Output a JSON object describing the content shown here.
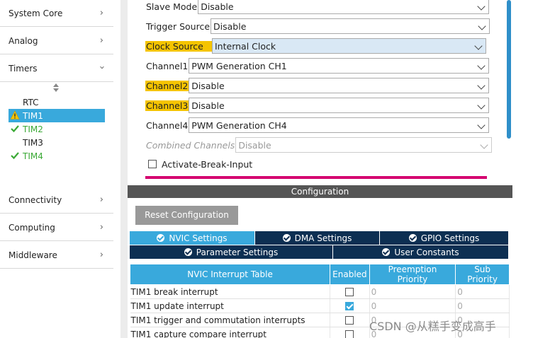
{
  "sidebar": {
    "categories": [
      {
        "label": "System Core",
        "icon": "chevron-right-icon"
      },
      {
        "label": "Analog",
        "icon": "chevron-right-icon"
      },
      {
        "label": "Timers",
        "icon": "chevron-down-icon"
      },
      {
        "label": "Connectivity",
        "icon": "chevron-right-icon"
      },
      {
        "label": "Computing",
        "icon": "chevron-right-icon"
      },
      {
        "label": "Middleware",
        "icon": "chevron-right-icon"
      }
    ],
    "timers": [
      {
        "label": "RTC",
        "status": "none"
      },
      {
        "label": "TIM1",
        "status": "warning",
        "selected": true
      },
      {
        "label": "TIM2",
        "status": "ok"
      },
      {
        "label": "TIM3",
        "status": "none"
      },
      {
        "label": "TIM4",
        "status": "ok"
      }
    ]
  },
  "mode": {
    "slave_mode": {
      "label": "Slave Mode",
      "value": "Disable"
    },
    "trigger_source": {
      "label": "Trigger Source",
      "value": "Disable"
    },
    "clock_source": {
      "label": "Clock Source",
      "value": "Internal Clock"
    },
    "channel1": {
      "label": "Channel1",
      "value": "PWM Generation CH1"
    },
    "channel2": {
      "label": "Channel2",
      "value": "Disable"
    },
    "channel3": {
      "label": "Channel3",
      "value": "Disable"
    },
    "channel4": {
      "label": "Channel4",
      "value": "PWM Generation CH4"
    },
    "combined": {
      "label": "Combined Channels",
      "value": "Disable"
    },
    "break_input": {
      "label": "Activate-Break-Input",
      "checked": false
    }
  },
  "config": {
    "title": "Configuration",
    "reset_label": "Reset Configuration",
    "tabs": [
      "NVIC Settings",
      "DMA Settings",
      "GPIO Settings",
      "Parameter Settings",
      "User Constants"
    ],
    "table": {
      "headers": [
        "NVIC Interrupt Table",
        "Enabled",
        "Preemption Priority",
        "Sub Priority"
      ],
      "rows": [
        {
          "name": "TIM1 break interrupt",
          "enabled": false,
          "preemption": "0",
          "sub": "0"
        },
        {
          "name": "TIM1 update interrupt",
          "enabled": true,
          "preemption": "0",
          "sub": "0"
        },
        {
          "name": "TIM1 trigger and commutation interrupts",
          "enabled": false,
          "preemption": "0",
          "sub": "0"
        },
        {
          "name": "TIM1 capture compare interrupt",
          "enabled": false,
          "preemption": "0",
          "sub": "0"
        }
      ]
    }
  },
  "watermark": "CSDN @从糕手变成高手",
  "colors": {
    "accent": "#39a9dc",
    "tab_dark": "#0d2f52",
    "highlight": "#f5c400",
    "ok": "#3aa935",
    "warning": "#f5c400",
    "pink": "#d4006f"
  }
}
